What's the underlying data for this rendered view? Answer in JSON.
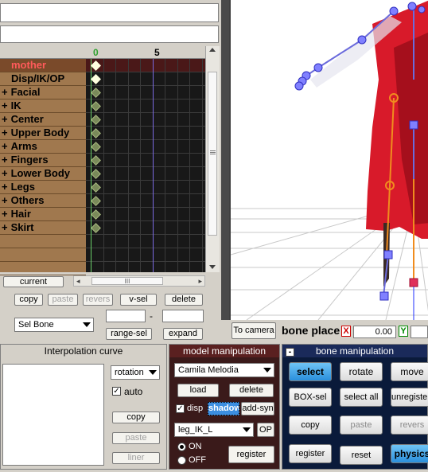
{
  "timeline": {
    "ruler_labels": [
      "0",
      "5"
    ],
    "tracks": [
      {
        "label": "mother",
        "prefix": "",
        "selected": true
      },
      {
        "label": "Disp/IK/OP",
        "prefix": "",
        "selected": false
      },
      {
        "label": "Facial",
        "prefix": "+",
        "selected": false
      },
      {
        "label": "IK",
        "prefix": "+",
        "selected": false
      },
      {
        "label": "Center",
        "prefix": "+",
        "selected": false
      },
      {
        "label": "Upper Body",
        "prefix": "+",
        "selected": false
      },
      {
        "label": "Arms",
        "prefix": "+",
        "selected": false
      },
      {
        "label": "Fingers",
        "prefix": "+",
        "selected": false
      },
      {
        "label": "Lower Body",
        "prefix": "+",
        "selected": false
      },
      {
        "label": "Legs",
        "prefix": "+",
        "selected": false
      },
      {
        "label": "Others",
        "prefix": "+",
        "selected": false
      },
      {
        "label": "Hair",
        "prefix": "+",
        "selected": false
      },
      {
        "label": "Skirt",
        "prefix": "+",
        "selected": false
      }
    ],
    "current_label": "current",
    "hscroll_thumb": "III",
    "buttons": {
      "copy": "copy",
      "paste": "paste",
      "revers": "revers",
      "vsel": "v-sel",
      "delete": "delete",
      "range_sel": "range-sel",
      "expand": "expand"
    },
    "sel_bone": "Sel Bone",
    "range_dash": "-"
  },
  "view": {
    "to_camera": "To camera",
    "bone_place": "bone place",
    "x_label": "X",
    "x_value": "0.00",
    "y_label": "Y"
  },
  "interp": {
    "title": "Interpolation curve",
    "mode": "rotation",
    "auto_label": "auto",
    "auto_checked": true,
    "copy": "copy",
    "paste": "paste",
    "liner": "liner"
  },
  "model": {
    "title": "model manipulation",
    "model_name": "Camila Melodia",
    "load": "load",
    "delete": "delete",
    "disp_label": "disp",
    "shadow": "shadow",
    "add_syn": "add-syn",
    "bone_select": "leg_IK_L",
    "op": "OP",
    "on": "ON",
    "off": "OFF",
    "register": "register"
  },
  "bone": {
    "title": "bone manipulation",
    "collapse": "-",
    "select": "select",
    "rotate": "rotate",
    "move": "move",
    "box_sel": "BOX-sel",
    "select_all": "select all",
    "unregistered": "unregistered",
    "copy": "copy",
    "paste": "paste",
    "revers": "revers",
    "register": "register",
    "reset": "reset",
    "physics": "physics"
  }
}
